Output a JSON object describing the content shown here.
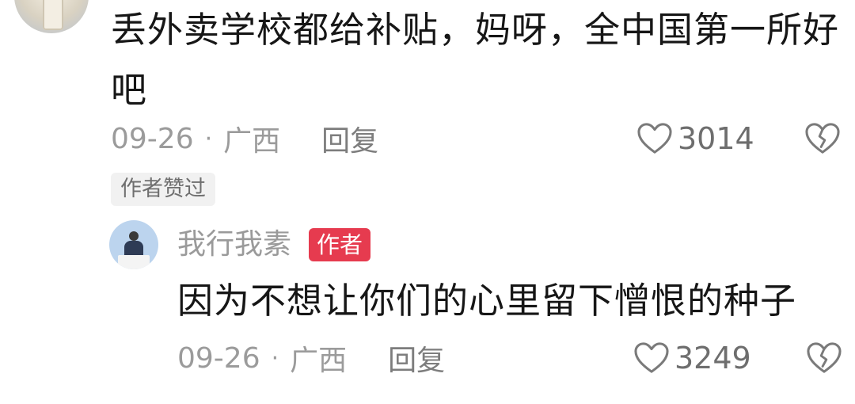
{
  "top_comment": {
    "text": "丢外卖学校都给补贴，妈呀，全中国第一所好吧",
    "date": "09-26",
    "location": "广西",
    "reply_label": "回复",
    "like_count": "3014",
    "author_liked_badge": "作者赞过"
  },
  "reply_comment": {
    "username": "我行我素",
    "author_badge": "作者",
    "text": "因为不想让你们的心里留下憎恨的种子",
    "date": "09-26",
    "location": "广西",
    "reply_label": "回复",
    "like_count": "3249"
  },
  "separator_dot": "·",
  "icons": {
    "like": "heart-outline-icon",
    "dislike": "broken-heart-icon"
  },
  "colors": {
    "author_badge_bg": "#e63b4f",
    "meta_text": "#9b9b9b"
  }
}
